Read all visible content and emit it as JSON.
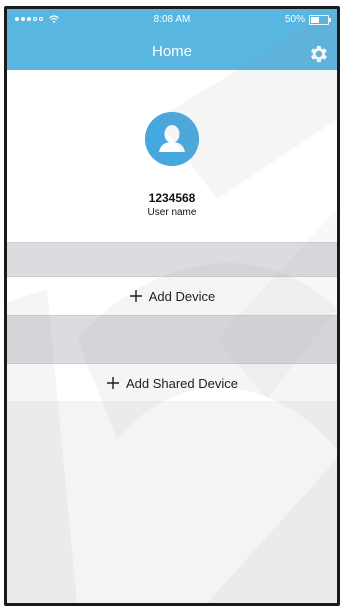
{
  "status_bar": {
    "time": "8:08 AM",
    "battery_percent": "50%",
    "battery_level": 0.5
  },
  "header": {
    "title": "Home",
    "settings_icon": "gear-icon"
  },
  "profile": {
    "avatar_icon": "user-icon",
    "user_id": "1234568",
    "user_name": "User name"
  },
  "actions": {
    "add_device": "Add Device",
    "add_shared_device": "Add Shared Device"
  },
  "colors": {
    "accent": "#58b6e1",
    "avatar": "#45a9e0",
    "band": "#dcdce0"
  }
}
